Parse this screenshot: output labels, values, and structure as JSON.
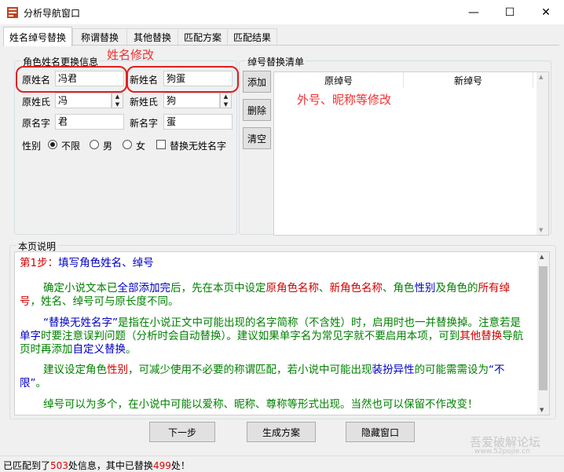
{
  "window": {
    "title": "分析导航窗口",
    "controls": {
      "minimize": "—",
      "maximize": "☐",
      "close": "✕"
    }
  },
  "tabs": [
    {
      "label": "姓名绰号替换",
      "active": true
    },
    {
      "label": "称谓替换"
    },
    {
      "label": "其他替换"
    },
    {
      "label": "匹配方案"
    },
    {
      "label": "匹配结果"
    }
  ],
  "role_group": {
    "legend": "角色姓名更换信息",
    "orig_fullname_label": "原姓名",
    "orig_fullname_value": "冯君",
    "new_fullname_label": "新姓名",
    "new_fullname_value": "狗蛋",
    "orig_surname_label": "原姓氏",
    "orig_surname_value": "冯",
    "new_surname_label": "新姓氏",
    "new_surname_value": "狗",
    "orig_given_label": "原名字",
    "orig_given_value": "君",
    "new_given_label": "新名字",
    "new_given_value": "蛋",
    "gender_label": "性别",
    "gender_options": [
      "不限",
      "男",
      "女"
    ],
    "gender_selected": "不限",
    "replace_no_surname_label": "替换无姓名字"
  },
  "nickname_group": {
    "legend": "绰号替换清单",
    "add_button": "添加",
    "delete_button": "删除",
    "clear_button": "清空",
    "col_orig": "原绰号",
    "col_new": "新绰号"
  },
  "annotations": {
    "name_edit": "姓名修改",
    "nickname_edit": "外号、昵称等修改",
    "annotation_color": "#f03030"
  },
  "description": {
    "legend": "本页说明",
    "step_prefix": "第1步：",
    "step_text": "填写角色姓名、绰号",
    "p1": [
      {
        "t": "确定小说文本已",
        "c": "green"
      },
      {
        "t": "全部添加完",
        "c": "blue"
      },
      {
        "t": "后，先在本页中设定",
        "c": "green"
      },
      {
        "t": "原角色名称",
        "c": "red"
      },
      {
        "t": "、",
        "c": "green"
      },
      {
        "t": "新角色名称",
        "c": "red"
      },
      {
        "t": "、角色",
        "c": "green"
      },
      {
        "t": "性别",
        "c": "blue"
      },
      {
        "t": "及角色的",
        "c": "green"
      },
      {
        "t": "所有绰号",
        "c": "red"
      },
      {
        "t": "，姓名、绰号可与原长度不同。",
        "c": "green"
      }
    ],
    "p2": [
      {
        "t": "“替换无姓名字”",
        "c": "blue"
      },
      {
        "t": "是指在小说正文中可能出现的名字简称（不含姓）时，启用时也一并替换掉。注意若是",
        "c": "green"
      },
      {
        "t": "单字",
        "c": "blue"
      },
      {
        "t": "时要注意误判问题（分析时会自动替换）。建议如果单字名为常见字就不要启用本项，可到",
        "c": "green"
      },
      {
        "t": "其他替换",
        "c": "red"
      },
      {
        "t": "导航页时再添加",
        "c": "green"
      },
      {
        "t": "自定义替换",
        "c": "blue"
      },
      {
        "t": "。",
        "c": "green"
      }
    ],
    "p3": [
      {
        "t": "建议设定角色",
        "c": "green"
      },
      {
        "t": "性别",
        "c": "red"
      },
      {
        "t": "，可减少使用不必要的称谓匹配，若小说中可能出现",
        "c": "green"
      },
      {
        "t": "装扮异性",
        "c": "blue"
      },
      {
        "t": "的可能需需设为",
        "c": "green"
      },
      {
        "t": "“不限”",
        "c": "blue"
      },
      {
        "t": "。",
        "c": "green"
      }
    ],
    "p4": [
      {
        "t": "绰号可以为多个，在小说中可能以爱称、昵称、尊称等形式出现。当然也可以保留不作改变！",
        "c": "green"
      }
    ]
  },
  "bottom_buttons": {
    "next": "下一步",
    "generate": "生成方案",
    "hide": "隐藏窗口"
  },
  "status": {
    "prefix": "已匹配到了",
    "matched": "503",
    "middle": "处信息，其中已替换",
    "replaced": "499",
    "suffix": "处！"
  },
  "watermark": {
    "line1": "吾爱破解论坛",
    "line2": "www.52pojie.cn"
  }
}
